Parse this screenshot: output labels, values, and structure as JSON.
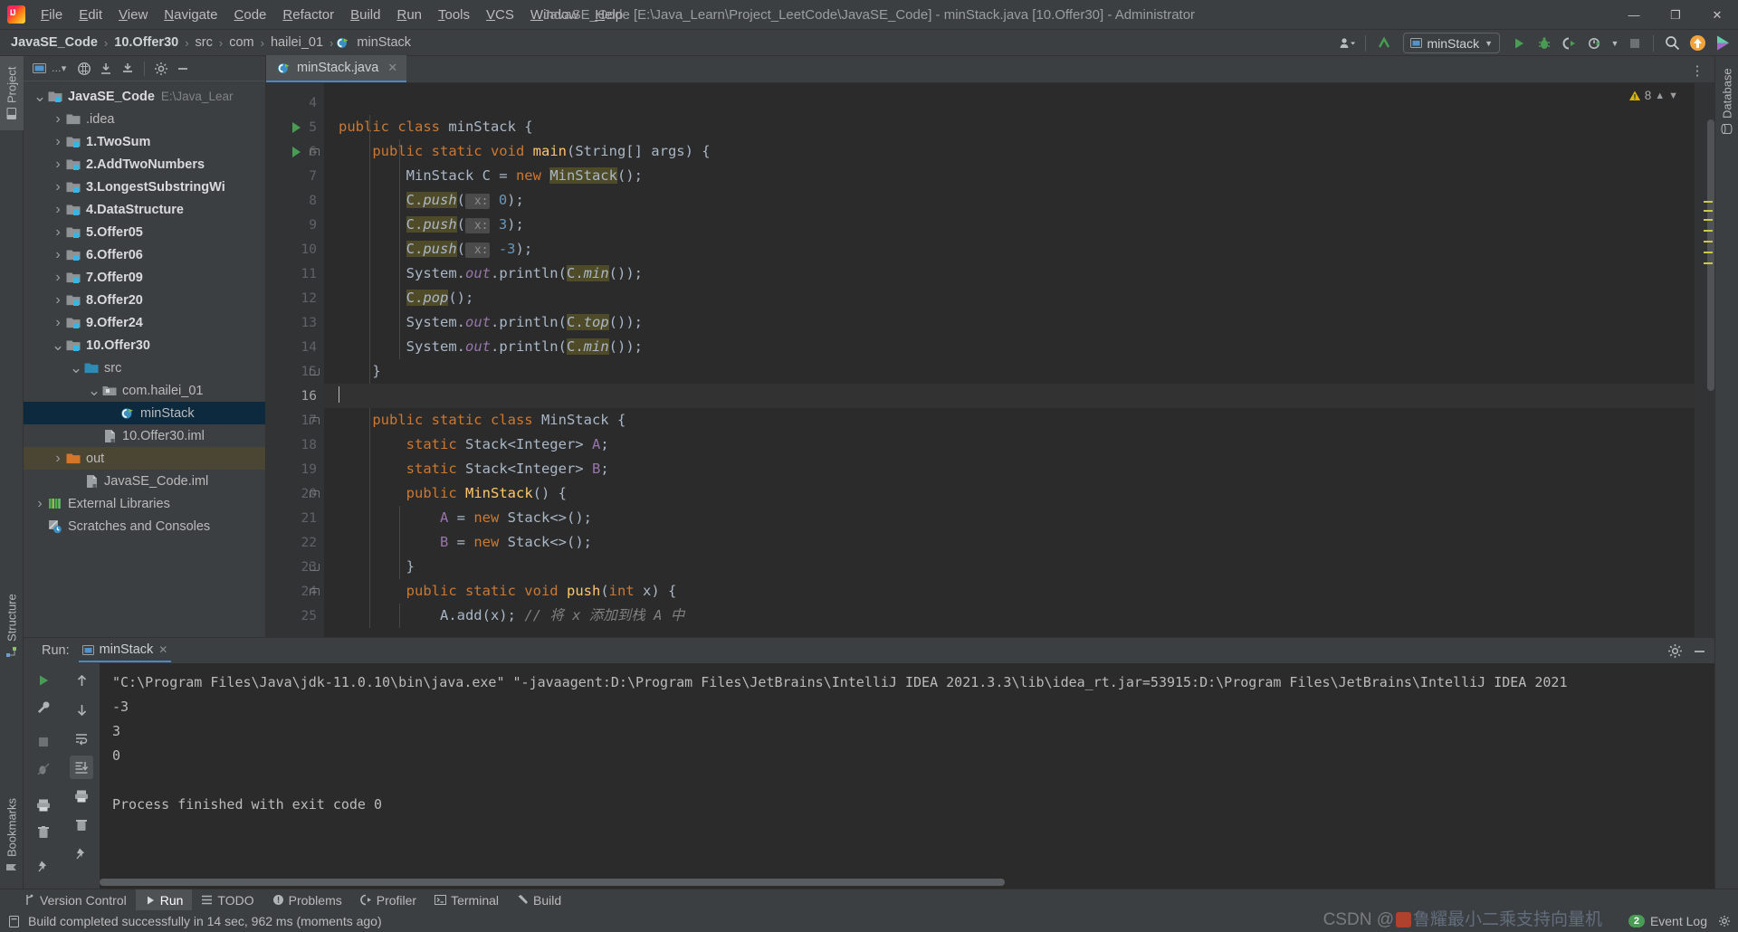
{
  "titlebar": {
    "logo_icon": "intellij-idea-logo",
    "menus": [
      "File",
      "Edit",
      "View",
      "Navigate",
      "Code",
      "Refactor",
      "Build",
      "Run",
      "Tools",
      "VCS",
      "Window",
      "Help"
    ],
    "window_title": "JavaSE_Code [E:\\Java_Learn\\Project_LeetCode\\JavaSE_Code] - minStack.java [10.Offer30] - Administrator",
    "minimize": "—",
    "maximize": "❐",
    "close": "✕"
  },
  "navbar": {
    "crumbs": [
      "JavaSE_Code",
      "10.Offer30",
      "src",
      "com",
      "hailei_01",
      "minStack"
    ],
    "separator": "›",
    "run_config": "minStack",
    "icons": [
      "account-icon",
      "update-project-icon",
      "run-icon",
      "debug-icon",
      "run-coverage-icon",
      "profiler-icon",
      "stop-icon",
      "search-icon",
      "updates-icon",
      "ide-features-icon"
    ]
  },
  "project_panel": {
    "tool_title": "Project",
    "toolbar_icons": [
      "project-view-select-icon",
      "collapse-icon",
      "expand-icon",
      "locate-icon",
      "settings-icon",
      "hide-icon"
    ],
    "tree": [
      {
        "depth": 0,
        "arrow": "down",
        "icon": "module-folder-icon",
        "label": "JavaSE_Code",
        "bold": true,
        "sub": "E:\\Java_Lear",
        "state": "normal"
      },
      {
        "depth": 1,
        "arrow": "right",
        "icon": "folder-icon",
        "label": ".idea",
        "bold": false,
        "sub": "",
        "state": "normal"
      },
      {
        "depth": 1,
        "arrow": "right",
        "icon": "module-folder-icon",
        "label": "1.TwoSum",
        "bold": true,
        "sub": "",
        "state": "normal"
      },
      {
        "depth": 1,
        "arrow": "right",
        "icon": "module-folder-icon",
        "label": "2.AddTwoNumbers",
        "bold": true,
        "sub": "",
        "state": "normal"
      },
      {
        "depth": 1,
        "arrow": "right",
        "icon": "module-folder-icon",
        "label": "3.LongestSubstringWi",
        "bold": true,
        "sub": "",
        "state": "normal"
      },
      {
        "depth": 1,
        "arrow": "right",
        "icon": "module-folder-icon",
        "label": "4.DataStructure",
        "bold": true,
        "sub": "",
        "state": "normal"
      },
      {
        "depth": 1,
        "arrow": "right",
        "icon": "module-folder-icon",
        "label": "5.Offer05",
        "bold": true,
        "sub": "",
        "state": "normal"
      },
      {
        "depth": 1,
        "arrow": "right",
        "icon": "module-folder-icon",
        "label": "6.Offer06",
        "bold": true,
        "sub": "",
        "state": "normal"
      },
      {
        "depth": 1,
        "arrow": "right",
        "icon": "module-folder-icon",
        "label": "7.Offer09",
        "bold": true,
        "sub": "",
        "state": "normal"
      },
      {
        "depth": 1,
        "arrow": "right",
        "icon": "module-folder-icon",
        "label": "8.Offer20",
        "bold": true,
        "sub": "",
        "state": "normal"
      },
      {
        "depth": 1,
        "arrow": "right",
        "icon": "module-folder-icon",
        "label": "9.Offer24",
        "bold": true,
        "sub": "",
        "state": "normal"
      },
      {
        "depth": 1,
        "arrow": "down",
        "icon": "module-folder-icon",
        "label": "10.Offer30",
        "bold": true,
        "sub": "",
        "state": "normal"
      },
      {
        "depth": 2,
        "arrow": "down",
        "icon": "source-folder-icon",
        "label": "src",
        "bold": false,
        "sub": "",
        "state": "normal"
      },
      {
        "depth": 3,
        "arrow": "down",
        "icon": "package-icon",
        "label": "com.hailei_01",
        "bold": false,
        "sub": "",
        "state": "normal"
      },
      {
        "depth": 4,
        "arrow": "none",
        "icon": "java-class-runnable-icon",
        "label": "minStack",
        "bold": false,
        "sub": "",
        "state": "selected"
      },
      {
        "depth": 3,
        "arrow": "none",
        "icon": "iml-file-icon",
        "label": "10.Offer30.iml",
        "bold": false,
        "sub": "",
        "state": "normal"
      },
      {
        "depth": 1,
        "arrow": "right",
        "icon": "out-folder-icon",
        "label": "out",
        "bold": false,
        "sub": "",
        "state": "highlight"
      },
      {
        "depth": 2,
        "arrow": "none",
        "icon": "iml-file-icon",
        "label": "JavaSE_Code.iml",
        "bold": false,
        "sub": "",
        "state": "normal"
      },
      {
        "depth": 0,
        "arrow": "right",
        "icon": "external-libraries-icon",
        "label": "External Libraries",
        "bold": false,
        "sub": "",
        "state": "normal"
      },
      {
        "depth": 0,
        "arrow": "none",
        "icon": "scratches-icon",
        "label": "Scratches and Consoles",
        "bold": false,
        "sub": "",
        "state": "normal"
      }
    ]
  },
  "editor": {
    "tab": {
      "label": "minStack.java",
      "icon": "java-class-runnable-icon",
      "close": "✕"
    },
    "warning_count": "8",
    "warning_icon": "warning-triangle-icon",
    "first_line_number": 4,
    "cursor_line": 16,
    "lines": [
      {
        "n": 4,
        "run": false,
        "fold": "none",
        "html": ""
      },
      {
        "n": 5,
        "run": true,
        "fold": "none",
        "html": "<span class=\"kw\">public class</span> minStack {"
      },
      {
        "n": 6,
        "run": true,
        "fold": "top",
        "html": "    <span class=\"kw\">public static void</span> <span class=\"meth\">main</span>(String[] args) {"
      },
      {
        "n": 7,
        "run": false,
        "fold": "none",
        "html": "        MinStack C = <span class=\"kw\">new</span> <span class=\"hlu\">MinStack</span>();"
      },
      {
        "n": 8,
        "run": false,
        "fold": "none",
        "html": "        <span class=\"hlu\">C.<span class=\"stat\">push</span></span>(<span class=\"param\"> x:</span> <span class=\"num\">0</span>);"
      },
      {
        "n": 9,
        "run": false,
        "fold": "none",
        "html": "        <span class=\"hlu\">C.<span class=\"stat\">push</span></span>(<span class=\"param\"> x:</span> <span class=\"num\">3</span>);"
      },
      {
        "n": 10,
        "run": false,
        "fold": "none",
        "html": "        <span class=\"hlu\">C.<span class=\"stat\">push</span></span>(<span class=\"param\"> x:</span> <span class=\"num\">-3</span>);"
      },
      {
        "n": 11,
        "run": false,
        "fold": "none",
        "html": "        System.<span class=\"field\">out</span>.println(<span class=\"hlu\">C.<span class=\"stat\">min</span></span>());"
      },
      {
        "n": 12,
        "run": false,
        "fold": "none",
        "html": "        <span class=\"hlu\">C.<span class=\"stat\">pop</span></span>();"
      },
      {
        "n": 13,
        "run": false,
        "fold": "none",
        "html": "        System.<span class=\"field\">out</span>.println(<span class=\"hlu\">C.<span class=\"stat\">top</span></span>());"
      },
      {
        "n": 14,
        "run": false,
        "fold": "none",
        "html": "        System.<span class=\"field\">out</span>.println(<span class=\"hlu\">C.<span class=\"stat\">min</span></span>());"
      },
      {
        "n": 15,
        "run": false,
        "fold": "bot",
        "html": "    }"
      },
      {
        "n": 16,
        "run": false,
        "fold": "none",
        "html": "<span class=\"caret\"></span>",
        "current": true
      },
      {
        "n": 17,
        "run": false,
        "fold": "top",
        "html": "    <span class=\"kw\">public static class</span> MinStack {"
      },
      {
        "n": 18,
        "run": false,
        "fold": "none",
        "html": "        <span class=\"kw\">static</span> Stack&lt;Integer&gt; <span class=\"fieldn\">A</span>;"
      },
      {
        "n": 19,
        "run": false,
        "fold": "none",
        "html": "        <span class=\"kw\">static</span> Stack&lt;Integer&gt; <span class=\"fieldn\">B</span>;"
      },
      {
        "n": 20,
        "run": false,
        "fold": "top",
        "html": "        <span class=\"kw\">public</span> <span class=\"meth\">MinStack</span>() {"
      },
      {
        "n": 21,
        "run": false,
        "fold": "none",
        "html": "            <span class=\"fieldn\">A</span> = <span class=\"kw\">new</span> Stack&lt;&gt;();"
      },
      {
        "n": 22,
        "run": false,
        "fold": "none",
        "html": "            <span class=\"fieldn\">B</span> = <span class=\"kw\">new</span> Stack&lt;&gt;();"
      },
      {
        "n": 23,
        "run": false,
        "fold": "bot",
        "html": "        }"
      },
      {
        "n": 24,
        "run": false,
        "fold": "top",
        "html": "        <span class=\"kw\">public static void</span> <span class=\"meth\">push</span>(<span class=\"kw\">int</span> x) {"
      },
      {
        "n": 25,
        "run": false,
        "fold": "none",
        "html": "            A.add(x); <span class=\"cmt\">// 将 x 添加到栈 A 中</span>"
      }
    ]
  },
  "run_panel": {
    "label": "Run:",
    "tab": "minStack",
    "tab_icon": "run-configuration-icon",
    "close": "✕",
    "settings_icon": "gear-icon",
    "hide_icon": "minimize-icon",
    "toolbar_icons": [
      "rerun-icon",
      "wrench-icon",
      "stop-icon",
      "trash-icon",
      "pin-icon"
    ],
    "toolbar2_icons": [
      "up-arrow-icon",
      "down-arrow-icon",
      "soft-wrap-icon",
      "scroll-to-end-icon",
      "print-icon"
    ],
    "console_lines": [
      "\"C:\\Program Files\\Java\\jdk-11.0.10\\bin\\java.exe\" \"-javaagent:D:\\Program Files\\JetBrains\\IntelliJ IDEA 2021.3.3\\lib\\idea_rt.jar=53915:D:\\Program Files\\JetBrains\\IntelliJ IDEA 2021",
      "-3",
      "3",
      "0",
      "",
      "Process finished with exit code 0"
    ]
  },
  "left_strip": {
    "tabs": [
      {
        "label": "Project",
        "icon": "project-icon",
        "active": true
      },
      {
        "label": "Structure",
        "icon": "structure-icon",
        "active": false
      },
      {
        "label": "Bookmarks",
        "icon": "bookmarks-icon",
        "active": false
      }
    ]
  },
  "right_strip": {
    "tabs": [
      {
        "label": "Database",
        "icon": "database-icon",
        "active": false
      }
    ]
  },
  "bottom_tabs": [
    {
      "label": "Version Control",
      "icon": "vcs-branch-icon",
      "active": false
    },
    {
      "label": "Run",
      "icon": "run-icon",
      "active": true
    },
    {
      "label": "TODO",
      "icon": "todo-list-icon",
      "active": false
    },
    {
      "label": "Problems",
      "icon": "problems-icon",
      "active": false
    },
    {
      "label": "Profiler",
      "icon": "profiler-icon",
      "active": false
    },
    {
      "label": "Terminal",
      "icon": "terminal-icon",
      "active": false
    },
    {
      "label": "Build",
      "icon": "build-hammer-icon",
      "active": false
    }
  ],
  "statusbar": {
    "icon": "build-status-icon",
    "message": "Build completed successfully in 14 sec, 962 ms (moments ago)",
    "event_log": "Event Log",
    "event_badge": "2",
    "settings_icon": "gear-icon"
  },
  "watermark": {
    "prefix": "CSDN @",
    "text": "鲁耀最小二乘支持向量机"
  },
  "colors": {
    "accent_blue": "#4a88c7",
    "selection": "#0d293e",
    "green_run": "#499c54",
    "editor_bg": "#2b2b2b",
    "panel_bg": "#3c3f41",
    "keyword": "#cc7832",
    "number": "#6897bb",
    "string": "#6a8759",
    "method": "#ffc66d",
    "field": "#9876aa",
    "warning": "#c9c94a"
  }
}
